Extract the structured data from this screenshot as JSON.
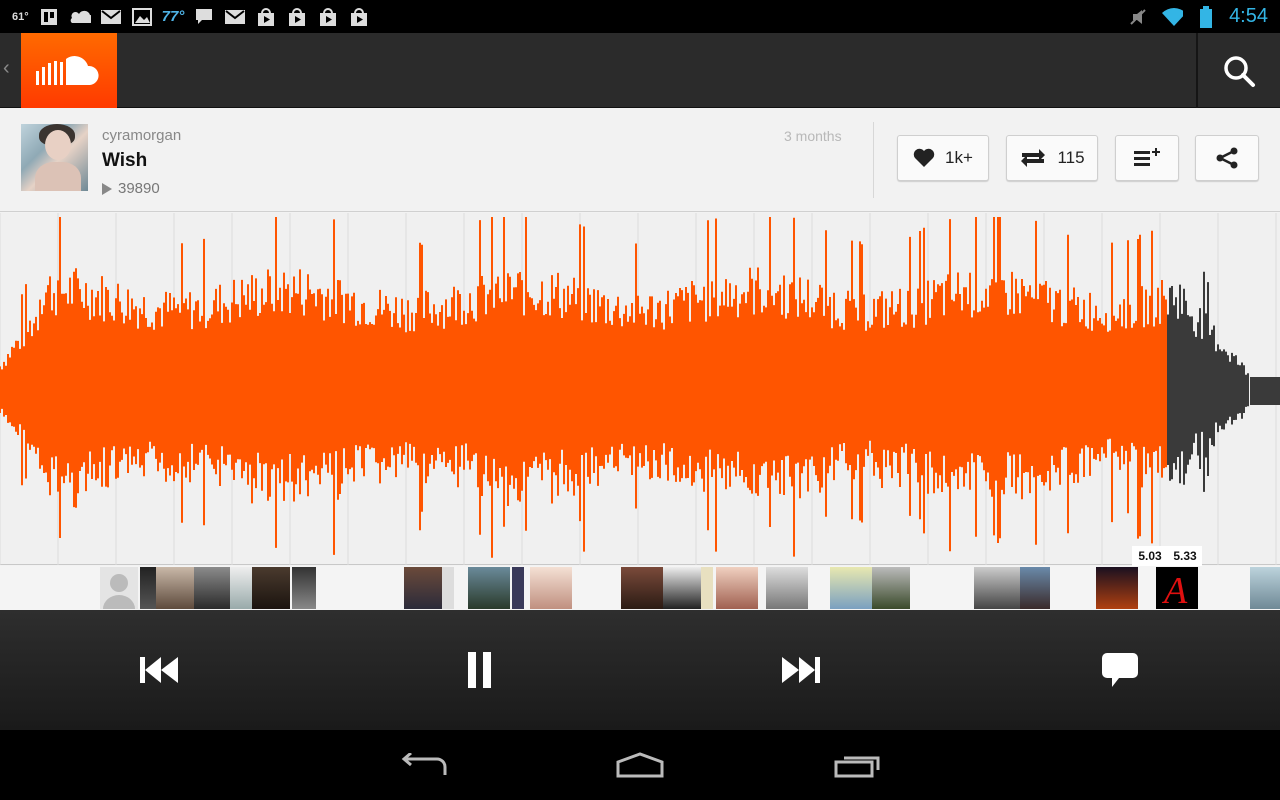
{
  "status_bar": {
    "temp_small": "61°",
    "temp_large": "77°",
    "time": "4:54",
    "left_icons": [
      "trello-icon",
      "cloud-icon",
      "gmail-icon",
      "gallery-icon",
      "weather-icon",
      "chat-icon",
      "gmail-icon",
      "play-store-icon",
      "play-store-icon",
      "play-store-icon",
      "play-store-icon"
    ],
    "right_icons": [
      "muted-icon",
      "wifi-icon",
      "battery-icon"
    ]
  },
  "action_bar": {
    "logo": "soundcloud-logo",
    "up": "‹",
    "search_icon": "search-icon"
  },
  "track": {
    "uploader": "cyramorgan",
    "title": "Wish",
    "plays": "39890",
    "age": "3 months"
  },
  "actions": {
    "like_count": "1k+",
    "repost_count": "115"
  },
  "player": {
    "progress": 0.91,
    "played_color": "#ff5500",
    "unplayed_color": "#3a3a3a"
  },
  "comment_times": [
    "5.03",
    "5.33"
  ],
  "colors": {
    "accent": "#ff5500",
    "status_time": "#33b5e5"
  }
}
